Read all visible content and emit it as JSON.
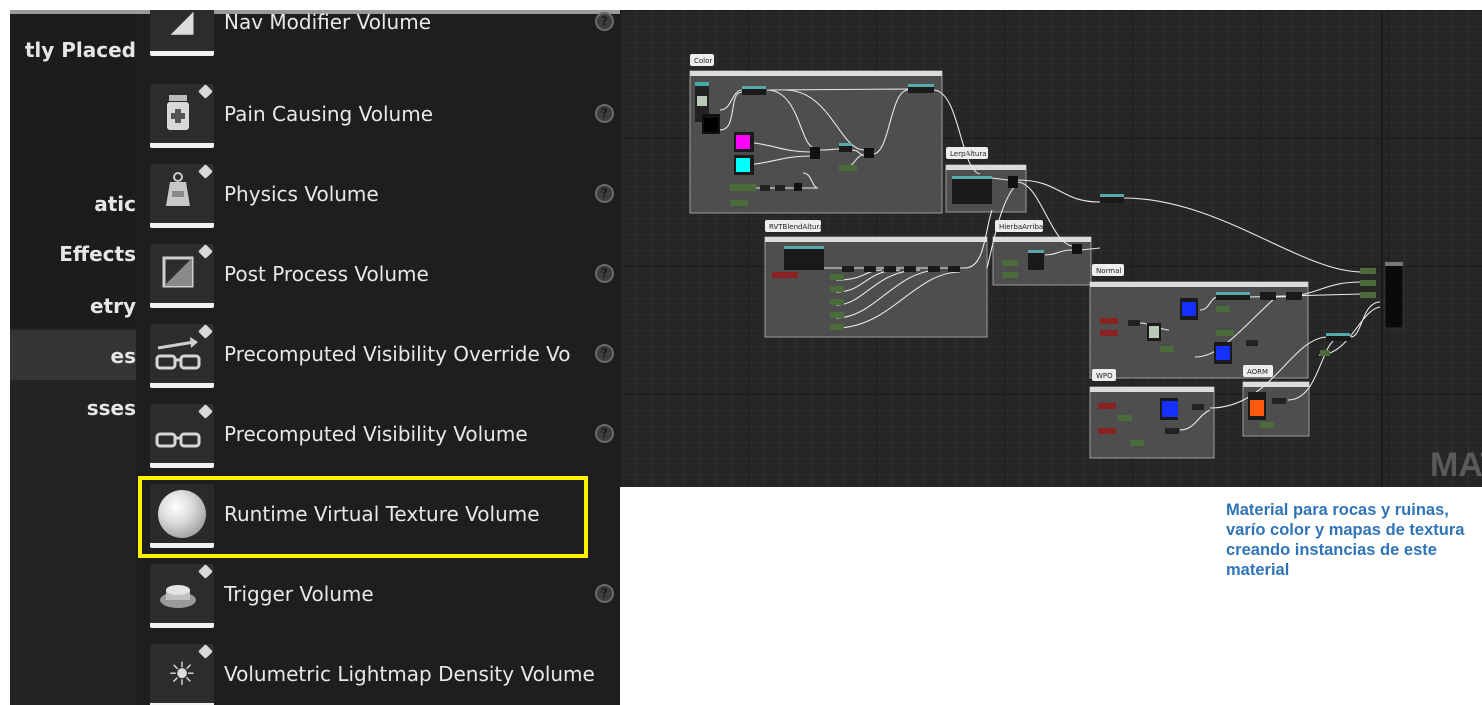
{
  "categories": [
    {
      "label": "tly Placed",
      "selected": false
    },
    {
      "label": "atic",
      "selected": false
    },
    {
      "label": "Effects",
      "selected": false
    },
    {
      "label": "etry",
      "selected": false
    },
    {
      "label": "es",
      "selected": true
    },
    {
      "label": "sses",
      "selected": false
    }
  ],
  "volumes": [
    {
      "label": "Nav Modifier Volume",
      "icon": "nav-modifier-icon",
      "help": true,
      "highlighted": false
    },
    {
      "label": "Pain Causing Volume",
      "icon": "pain-causing-icon",
      "help": true,
      "highlighted": false
    },
    {
      "label": "Physics Volume",
      "icon": "physics-icon",
      "help": true,
      "highlighted": false
    },
    {
      "label": "Post Process Volume",
      "icon": "post-process-icon",
      "help": true,
      "highlighted": false
    },
    {
      "label": "Precomputed Visibility Override Vo",
      "icon": "visibility-override-icon",
      "help": true,
      "highlighted": false
    },
    {
      "label": "Precomputed Visibility Volume",
      "icon": "visibility-volume-icon",
      "help": true,
      "highlighted": false
    },
    {
      "label": "Runtime Virtual Texture Volume",
      "icon": "sphere-icon",
      "help": false,
      "highlighted": true
    },
    {
      "label": "Trigger Volume",
      "icon": "trigger-icon",
      "help": true,
      "highlighted": false
    },
    {
      "label": "Volumetric Lightmap Density Volume",
      "icon": "lightmap-icon",
      "help": false,
      "highlighted": false
    }
  ],
  "graph": {
    "comments": [
      {
        "title": "Color"
      },
      {
        "title": "LerpAltura"
      },
      {
        "title": "RVTBlendAltura"
      },
      {
        "title": "HierbaArriba"
      },
      {
        "title": "Normal"
      },
      {
        "title": "WPO"
      },
      {
        "title": "AORM"
      }
    ],
    "watermark": "MAT",
    "colors": {
      "magenta": "#ff00ff",
      "cyan": "#00ffff",
      "blue": "#1530ff",
      "orange": "#ff5a10",
      "output": "#0a0a0a"
    }
  },
  "caption": "Material para rocas y ruinas, varío color y mapas de textura creando instancias de este material"
}
